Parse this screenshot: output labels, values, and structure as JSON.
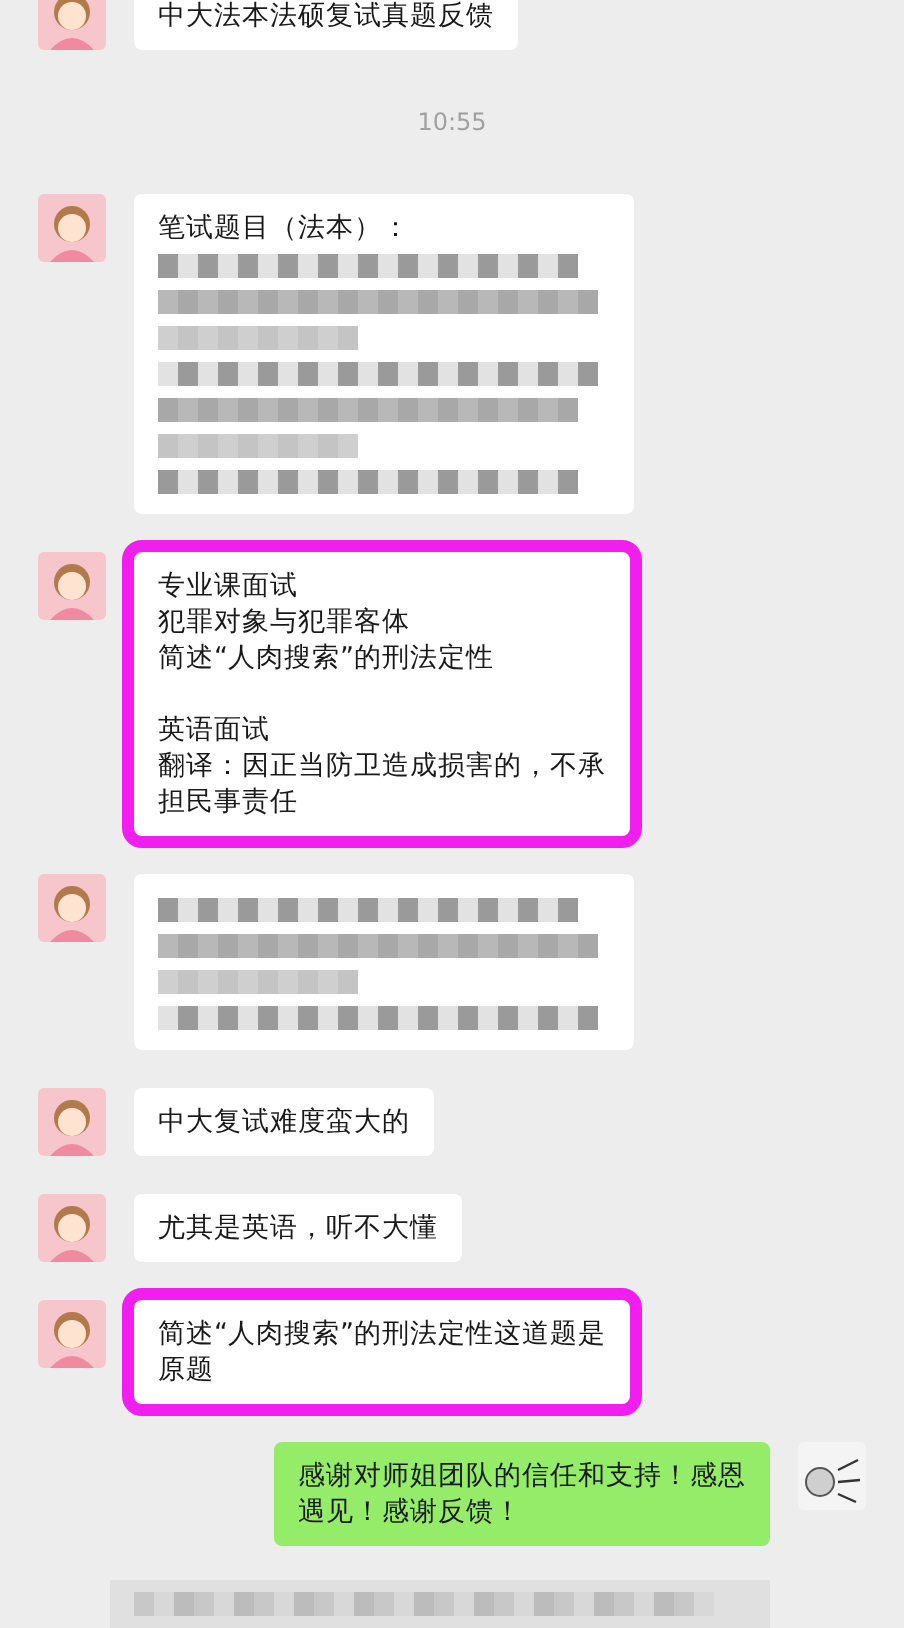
{
  "messages": [
    {
      "kind": "text",
      "outgoing": false,
      "highlighted": false,
      "paragraphs": [
        [
          "中大法本法硕复试真题反馈"
        ]
      ]
    },
    {
      "kind": "time",
      "text": "10:55"
    },
    {
      "kind": "text_blurred",
      "outgoing": false,
      "highlighted": false,
      "paragraphs": [
        [
          "笔试题目（法本）："
        ]
      ]
    },
    {
      "kind": "text",
      "outgoing": false,
      "highlighted": true,
      "paragraphs": [
        [
          "专业课面试",
          "犯罪对象与犯罪客体",
          "简述“人肉搜索”的刑法定性"
        ],
        [
          "英语面试",
          "翻译：因正当防卫造成损害的，不承",
          "担民事责任"
        ]
      ]
    },
    {
      "kind": "blurred",
      "outgoing": false,
      "highlighted": false
    },
    {
      "kind": "text",
      "outgoing": false,
      "highlighted": false,
      "paragraphs": [
        [
          "中大复试难度蛮大的"
        ]
      ]
    },
    {
      "kind": "text",
      "outgoing": false,
      "highlighted": false,
      "paragraphs": [
        [
          "尤其是英语，听不大懂"
        ]
      ]
    },
    {
      "kind": "text",
      "outgoing": false,
      "highlighted": true,
      "paragraphs": [
        [
          "简述“人肉搜索”的刑法定性这道题是",
          "原题"
        ]
      ]
    },
    {
      "kind": "text",
      "outgoing": true,
      "highlighted": false,
      "paragraphs": [
        [
          "感谢对师姐团队的信任和支持！感恩",
          "遇见！感谢反馈！"
        ]
      ]
    }
  ]
}
